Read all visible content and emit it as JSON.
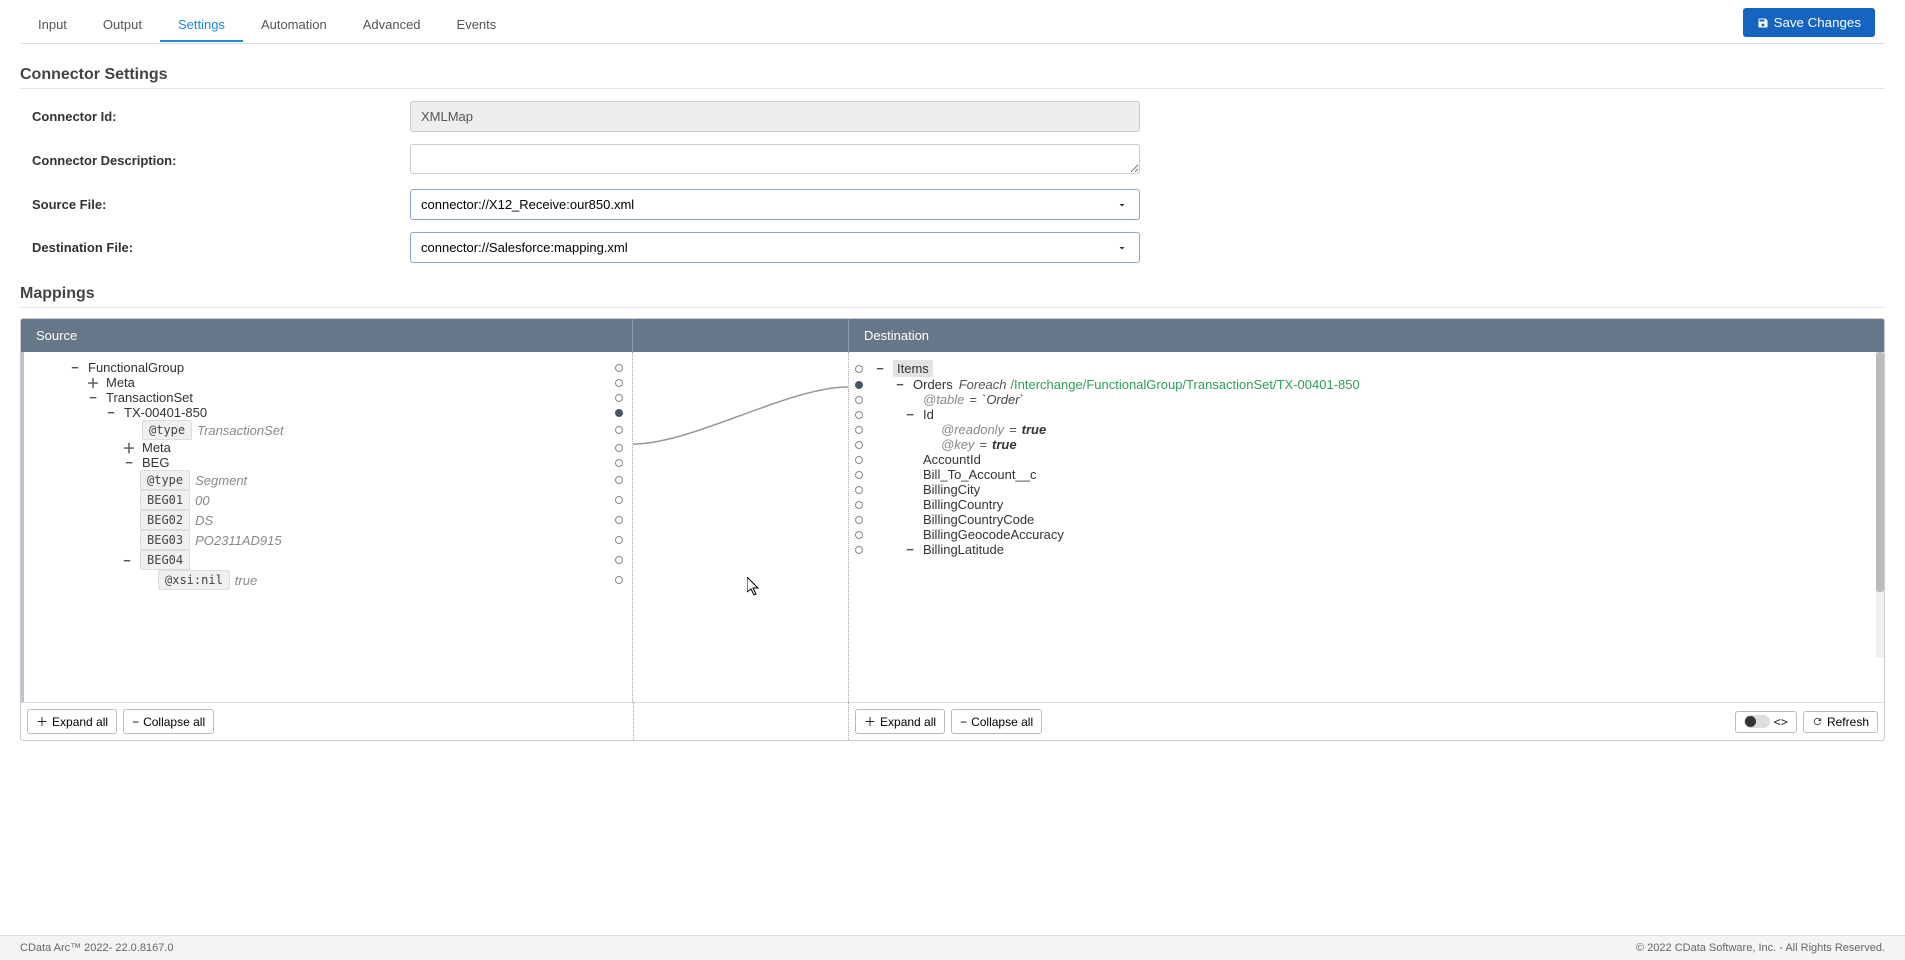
{
  "tabs": {
    "input": "Input",
    "output": "Output",
    "settings": "Settings",
    "automation": "Automation",
    "advanced": "Advanced",
    "events": "Events"
  },
  "saveBtn": "Save Changes",
  "section1Title": "Connector Settings",
  "form": {
    "connectorIdLabel": "Connector Id:",
    "connectorIdValue": "XMLMap",
    "connectorDescLabel": "Connector Description:",
    "connectorDescValue": "",
    "sourceFileLabel": "Source File:",
    "sourceFileValue": "connector://X12_Receive:our850.xml",
    "destFileLabel": "Destination File:",
    "destFileValue": "connector://Salesforce:mapping.xml"
  },
  "section2Title": "Mappings",
  "mappingHeader": {
    "source": "Source",
    "destination": "Destination"
  },
  "srcTree": {
    "functionalGroup": "FunctionalGroup",
    "meta": "Meta",
    "transactionSet": "TransactionSet",
    "tx": "TX-00401-850",
    "atType": "@type",
    "tsVal": "TransactionSet",
    "meta2": "Meta",
    "beg": "BEG",
    "segVal": "Segment",
    "beg01": "BEG01",
    "beg01v": "00",
    "beg02": "BEG02",
    "beg02v": "DS",
    "beg03": "BEG03",
    "beg03v": "PO2311AD915",
    "beg04": "BEG04",
    "xsinil": "@xsi:nil",
    "trueVal": "true"
  },
  "destTree": {
    "items": "Items",
    "orders": "Orders",
    "foreach": "Foreach",
    "path": "/Interchange/FunctionalGroup/TransactionSet/TX-00401-850",
    "atTable": "@table",
    "order": "`Order`",
    "id": "Id",
    "atReadonly": "@readonly",
    "eqTrue": "true",
    "atKey": "@key",
    "accountId": "AccountId",
    "billTo": "Bill_To_Account__c",
    "billingCity": "BillingCity",
    "billingCountry": "BillingCountry",
    "billingCountryCode": "BillingCountryCode",
    "billingGeo": "BillingGeocodeAccuracy",
    "billingLat": "BillingLatitude"
  },
  "toolbar": {
    "expandAll": "Expand all",
    "collapseAll": "Collapse all",
    "refresh": "Refresh"
  },
  "footer": {
    "left": "CData Arc™ 2022- 22.0.8167.0",
    "right": "© 2022 CData Software, Inc. - All Rights Reserved."
  }
}
